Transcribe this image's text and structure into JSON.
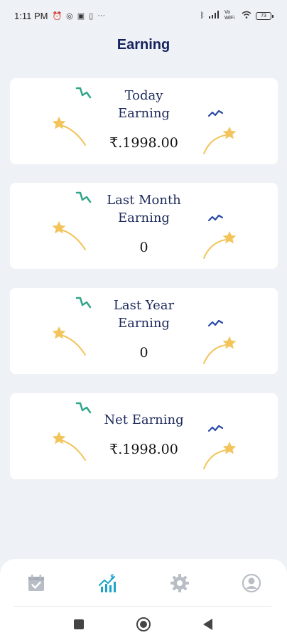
{
  "status_bar": {
    "time": "1:11 PM",
    "left_icons": [
      "alarm-icon",
      "whatsapp-icon",
      "message-icon",
      "sim-icon"
    ],
    "more": "···",
    "network": "Vo WiFi",
    "battery": "73"
  },
  "page": {
    "title": "Earning"
  },
  "cards": [
    {
      "label_line1": "Today",
      "label_line2": "Earning",
      "value": "₹.1998.00"
    },
    {
      "label_line1": "Last Month",
      "label_line2": "Earning",
      "value": "0"
    },
    {
      "label_line1": "Last Year",
      "label_line2": "Earning",
      "value": "0"
    },
    {
      "label_line1": "Net Earning",
      "label_line2": "",
      "value": "₹.1998.00"
    }
  ],
  "bottom_nav": {
    "items": [
      {
        "icon": "calendar-check-icon",
        "active": false
      },
      {
        "icon": "earning-chart-icon",
        "active": true
      },
      {
        "icon": "settings-gear-icon",
        "active": false
      },
      {
        "icon": "profile-icon",
        "active": false
      }
    ]
  },
  "system_nav": [
    "recent-apps-icon",
    "home-icon",
    "back-icon"
  ],
  "colors": {
    "background": "#eef1f5",
    "title": "#15225e",
    "active_nav": "#1aa5c8",
    "inactive_nav": "#b9bec6",
    "star": "#f2c45a",
    "squiggle_green": "#2fa58a",
    "squiggle_blue": "#2a4aa8"
  }
}
